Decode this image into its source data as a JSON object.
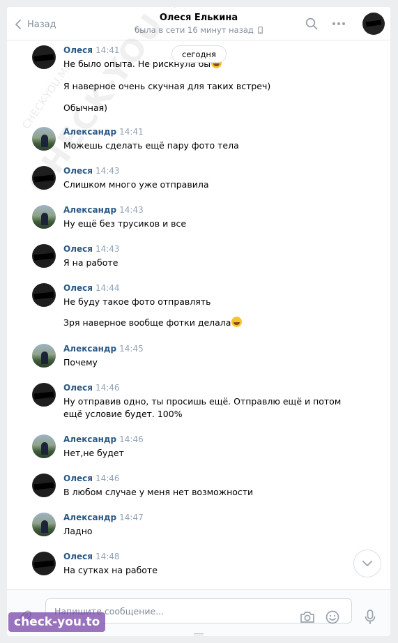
{
  "header": {
    "back_label": "Назад",
    "title": "Олеся Елькина",
    "status": "была в сети 16 минут назад"
  },
  "date_divider": "сегодня",
  "messages": [
    {
      "author": "Олеся",
      "time": "14:41",
      "avatar": "dark",
      "lines": [
        "Не было опыта. Не рискнула бы",
        "Я наверное очень скучная для таких встреч)",
        "Обычная)"
      ]
    },
    {
      "author": "Александр",
      "time": "14:41",
      "avatar": "photo",
      "lines": [
        "Можешь сделать ещё пару фото тела"
      ]
    },
    {
      "author": "Олеся",
      "time": "14:43",
      "avatar": "dark",
      "lines": [
        "Слишком много уже отправила"
      ]
    },
    {
      "author": "Александр",
      "time": "14:43",
      "avatar": "photo",
      "lines": [
        "Ну ещё без трусиков и все"
      ]
    },
    {
      "author": "Олеся",
      "time": "14:43",
      "avatar": "dark",
      "lines": [
        "Я на работе"
      ]
    },
    {
      "author": "Олеся",
      "time": "14:44",
      "avatar": "dark",
      "lines": [
        "Не буду такое фото отправлять",
        "Зря наверное вообще фотки делала"
      ]
    },
    {
      "author": "Александр",
      "time": "14:45",
      "avatar": "photo",
      "lines": [
        "Почему"
      ]
    },
    {
      "author": "Олеся",
      "time": "14:46",
      "avatar": "dark",
      "lines": [
        "Ну отправив одно, ты просишь ещё. Отправлю ещё и потом",
        "ещё условие будет. 100%"
      ]
    },
    {
      "author": "Александр",
      "time": "14:46",
      "avatar": "photo",
      "lines": [
        "Нет,не будет"
      ]
    },
    {
      "author": "Олеся",
      "time": "14:46",
      "avatar": "dark",
      "lines": [
        "В любом случае у меня нет возможности"
      ]
    },
    {
      "author": "Александр",
      "time": "14:47",
      "avatar": "photo",
      "lines": [
        "Ладно"
      ]
    },
    {
      "author": "Олеся",
      "time": "14:48",
      "avatar": "dark",
      "lines": [
        "На сутках на работе"
      ]
    }
  ],
  "composer": {
    "placeholder": "Напишите сообщение..."
  },
  "watermarks": {
    "diagonal": "CHECK-YOU.ME",
    "small": "CHECK-YOU.ME",
    "badge": "check-you.to"
  },
  "colors": {
    "author": "#2a5885",
    "time": "#93a3b5",
    "muted": "#818c99",
    "icon": "#99a2ad"
  }
}
